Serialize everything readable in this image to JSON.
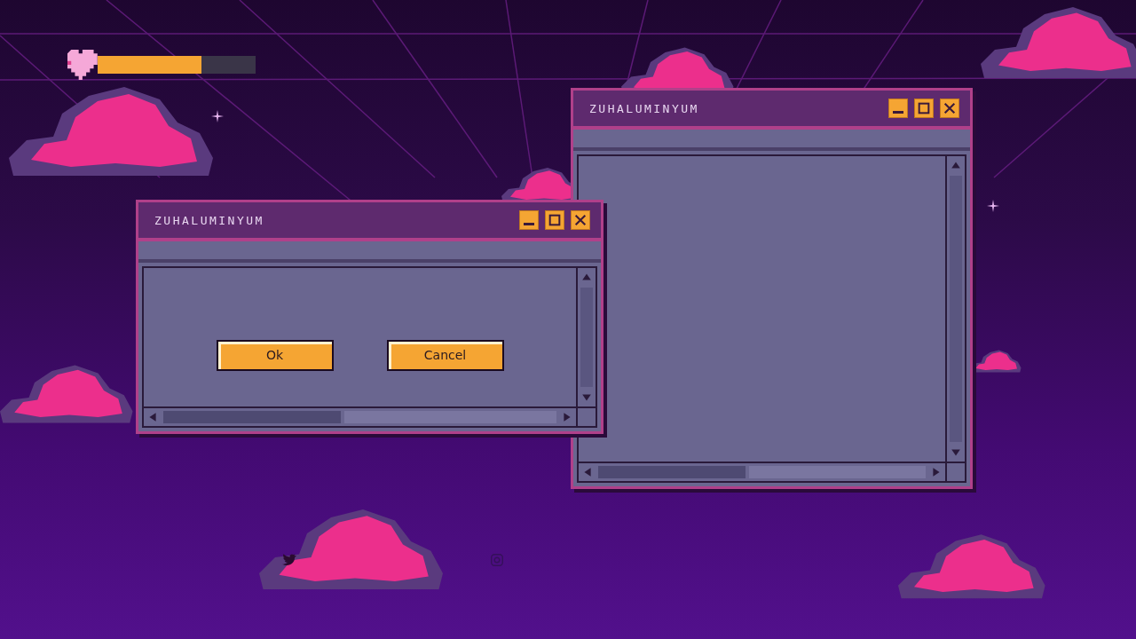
{
  "health_bar": {
    "level": 0.66
  },
  "windows": [
    {
      "title": "ZUHALUMINYUM",
      "kind": "empty"
    },
    {
      "title": "ZUHALUMINYUM",
      "kind": "dialog",
      "buttons": [
        "Ok",
        "Cancel"
      ]
    }
  ]
}
